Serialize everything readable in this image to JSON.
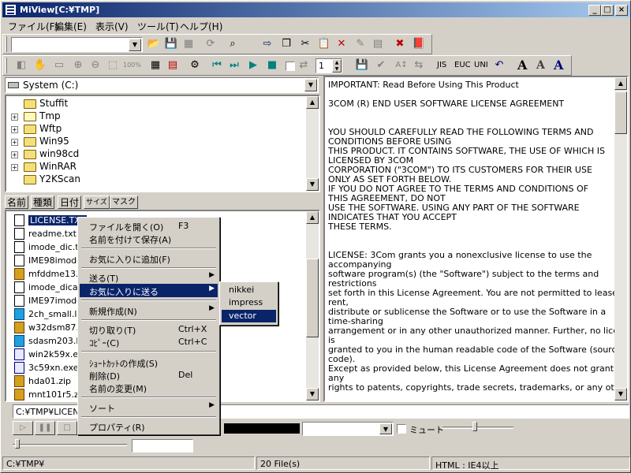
{
  "window": {
    "title": "MiView[C:¥TMP]"
  },
  "titlebar_buttons": {
    "minimize": "_",
    "maximize": "□",
    "close": "×"
  },
  "menu": [
    "ファイル(F)",
    "編集(E)",
    "表示(V)",
    "ツール(T)",
    "ヘルプ(H)"
  ],
  "toolbar2": {
    "jis": "JIS",
    "euc": "EUC",
    "uni": "UNI",
    "font_a1": "A",
    "font_a2": "A",
    "font_a3": "A",
    "page_value": "1",
    "zoom": "100%"
  },
  "drive": {
    "label": "System (C:)"
  },
  "tree": [
    {
      "name": "Stuffit",
      "expandable": false
    },
    {
      "name": "Tmp",
      "expandable": true
    },
    {
      "name": "Wftp",
      "expandable": true
    },
    {
      "name": "Win95",
      "expandable": true
    },
    {
      "name": "win98cd",
      "expandable": true
    },
    {
      "name": "WinRAR",
      "expandable": true
    },
    {
      "name": "Y2KScan",
      "expandable": false
    }
  ],
  "tabs": [
    "名前",
    "種類",
    "日付",
    "サイズ",
    "マスク"
  ],
  "files": [
    {
      "name": "LICENSE.TXT",
      "type": "txt",
      "selected": true
    },
    {
      "name": "readme.txt",
      "type": "txt"
    },
    {
      "name": "imode_dic.txt",
      "type": "txt"
    },
    {
      "name": "IME98imode.d",
      "type": "txt"
    },
    {
      "name": "mfddme13.zip",
      "type": "zip"
    },
    {
      "name": "imode_dica.txt",
      "type": "txt"
    },
    {
      "name": "IME97imode.d",
      "type": "txt"
    },
    {
      "name": "2ch_small.lzh",
      "type": "lzh"
    },
    {
      "name": "w32dsm87.zip",
      "type": "zip"
    },
    {
      "name": "sdasm203.lzh",
      "type": "lzh"
    },
    {
      "name": "win2k59x.exe",
      "type": "exe"
    },
    {
      "name": "3c59xn.exe",
      "type": "exe"
    },
    {
      "name": "hda01.zip",
      "type": "zip"
    },
    {
      "name": "mnt101r5.zip",
      "type": "zip"
    }
  ],
  "context_menu": {
    "open": {
      "label": "ファイルを開く(O)",
      "shortcut": "F3"
    },
    "save_as": {
      "label": "名前を付けて保存(A)"
    },
    "add_favorite": {
      "label": "お気に入りに追加(F)"
    },
    "send_to": {
      "label": "送る(T)"
    },
    "send_favorite": {
      "label": "お気に入りに送る"
    },
    "new": {
      "label": "新規作成(N)"
    },
    "cut": {
      "label": "切り取り(T)",
      "shortcut": "Ctrl+X"
    },
    "copy": {
      "label": "ｺﾋﾟｰ(C)",
      "shortcut": "Ctrl+C"
    },
    "shortcut": {
      "label": "ｼｮｰﾄｶｯﾄの作成(S)"
    },
    "delete": {
      "label": "削除(D)",
      "shortcut": "Del"
    },
    "rename": {
      "label": "名前の変更(M)"
    },
    "sort": {
      "label": "ソート"
    },
    "properties": {
      "label": "プロパティ(R)"
    }
  },
  "submenu": [
    "nikkei",
    "impress",
    "vector"
  ],
  "path_field": "C:¥TMP¥LICENSE",
  "mute_label": "ミュート",
  "text_lines": [
    "IMPORTANT:  Read Before Using This Product",
    "",
    "3COM (R) END USER SOFTWARE LICENSE AGREEMENT",
    "",
    "",
    "YOU SHOULD CAREFULLY READ THE FOLLOWING TERMS AND",
    "CONDITIONS BEFORE USING",
    "THIS PRODUCT.  IT CONTAINS SOFTWARE, THE USE OF WHICH IS",
    "LICENSED BY 3COM",
    "CORPORATION (\"3COM\") TO ITS CUSTOMERS FOR THEIR USE",
    "ONLY AS SET FORTH BELOW.",
    "IF YOU DO NOT AGREE TO THE TERMS AND CONDITIONS OF",
    "THIS AGREEMENT, DO NOT",
    "USE THE SOFTWARE.  USING ANY PART OF THE SOFTWARE",
    "INDICATES THAT YOU ACCEPT",
    "THESE TERMS.",
    "",
    "",
    "LICENSE:  3Com grants you a nonexclusive license to use the",
    "accompanying",
    "software program(s) (the \"Software\") subject to the terms and",
    "restrictions",
    "set forth in this License Agreement.  You are not permitted to lease,",
    "rent,",
    "distribute or sublicense the Software or to use the Software in a",
    "time-sharing",
    "arrangement or in any other unauthorized manner.  Further, no license",
    "is",
    "granted to you in the human readable code of the Software (source",
    "code).",
    "Except as provided below, this License Agreement does not grant you",
    "any",
    "rights to patents, copyrights, trade secrets, trademarks, or any other"
  ],
  "status": {
    "path": "C:¥TMP¥",
    "count": "20 File(s)",
    "html": "HTML : IE4以上"
  }
}
